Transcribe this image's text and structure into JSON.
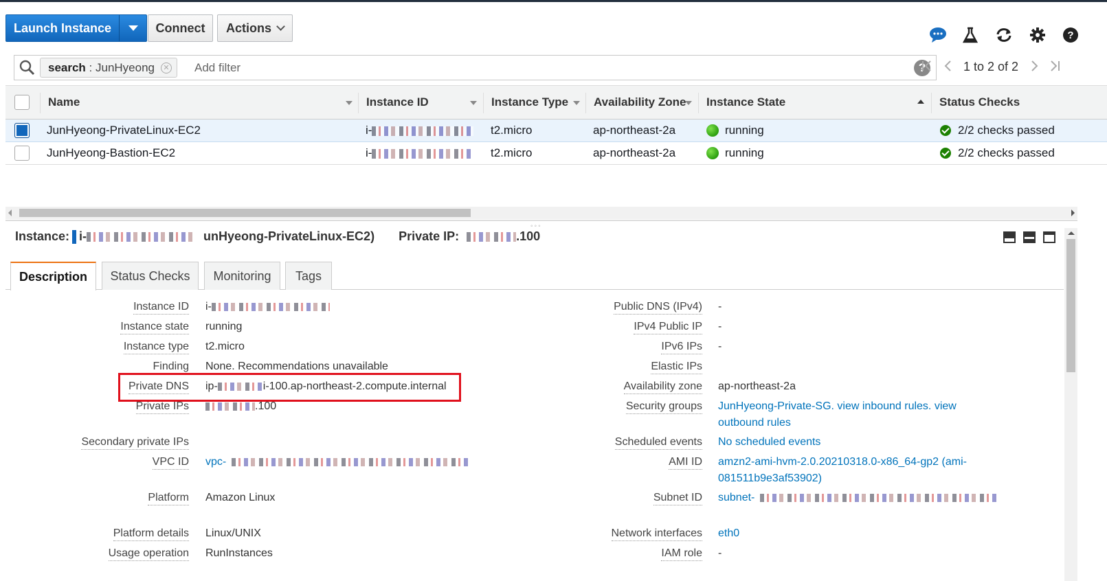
{
  "toolbar": {
    "launch_label": "Launch Instance",
    "connect_label": "Connect",
    "actions_label": "Actions"
  },
  "top_icons": [
    "chat-icon",
    "lab-icon",
    "refresh-icon",
    "settings-icon",
    "help-icon"
  ],
  "search": {
    "chip_key": "search",
    "chip_sep": " : ",
    "chip_value": "JunHyeong",
    "placeholder": "Add filter",
    "help": "?"
  },
  "pager": {
    "range": "1 to 2 of 2"
  },
  "grid": {
    "columns": [
      "Name",
      "Instance ID",
      "Instance Type",
      "Availability Zone",
      "Instance State",
      "Status Checks"
    ],
    "rows": [
      {
        "name": "JunHyeong-PrivateLinux-EC2",
        "id_prefix": "i-",
        "type": "t2.micro",
        "az": "ap-northeast-2a",
        "state": "running",
        "checks": "2/2 checks passed",
        "selected": true
      },
      {
        "name": "JunHyeong-Bastion-EC2",
        "id_prefix": "i-",
        "type": "t2.micro",
        "az": "ap-northeast-2a",
        "state": "running",
        "checks": "2/2 checks passed",
        "selected": false
      }
    ]
  },
  "detail_header": {
    "instance_label": "Instance:",
    "instance_prefix": "i-",
    "instance_tail": "unHyeong-PrivateLinux-EC2)",
    "private_ip_label": "Private IP:",
    "private_ip_tail": ".100"
  },
  "tabs": [
    "Description",
    "Status Checks",
    "Monitoring",
    "Tags"
  ],
  "description": {
    "left": [
      {
        "label": "Instance ID",
        "value": "i-"
      },
      {
        "label": "Instance state",
        "value": "running"
      },
      {
        "label": "Instance type",
        "value": "t2.micro"
      },
      {
        "label": "Finding",
        "value": "None. Recommendations unavailable"
      },
      {
        "label": "Private DNS",
        "value_prefix": "ip-",
        "value": "i-100.ap-northeast-2.compute.internal"
      },
      {
        "label": "Private IPs",
        "value": ".100"
      },
      {
        "label": "Secondary private IPs",
        "value": ""
      },
      {
        "label": "VPC ID",
        "value": "vpc-"
      },
      {
        "label": "Platform",
        "value": "Amazon Linux"
      },
      {
        "label": "Platform details",
        "value": "Linux/UNIX"
      },
      {
        "label": "Usage operation",
        "value": "RunInstances"
      }
    ],
    "right": [
      {
        "label": "Public DNS (IPv4)",
        "value": "-"
      },
      {
        "label": "IPv4 Public IP",
        "value": "-"
      },
      {
        "label": "IPv6 IPs",
        "value": "-"
      },
      {
        "label": "Elastic IPs",
        "value": ""
      },
      {
        "label": "Availability zone",
        "value": "ap-northeast-2a"
      },
      {
        "label": "Security groups",
        "value": "JunHyeong-Private-SG. view inbound rules. view",
        "value2": "outbound rules"
      },
      {
        "label": "Scheduled events",
        "value": "No scheduled events"
      },
      {
        "label": "AMI ID",
        "value": "amzn2-ami-hvm-2.0.20210318.0-x86_64-gp2 (ami-",
        "value2": "081511b9e3af53902)"
      },
      {
        "label": "Subnet ID",
        "value": "subnet-"
      },
      {
        "label": "Network interfaces",
        "value": "eth0"
      },
      {
        "label": "IAM role",
        "value": "-"
      }
    ]
  }
}
